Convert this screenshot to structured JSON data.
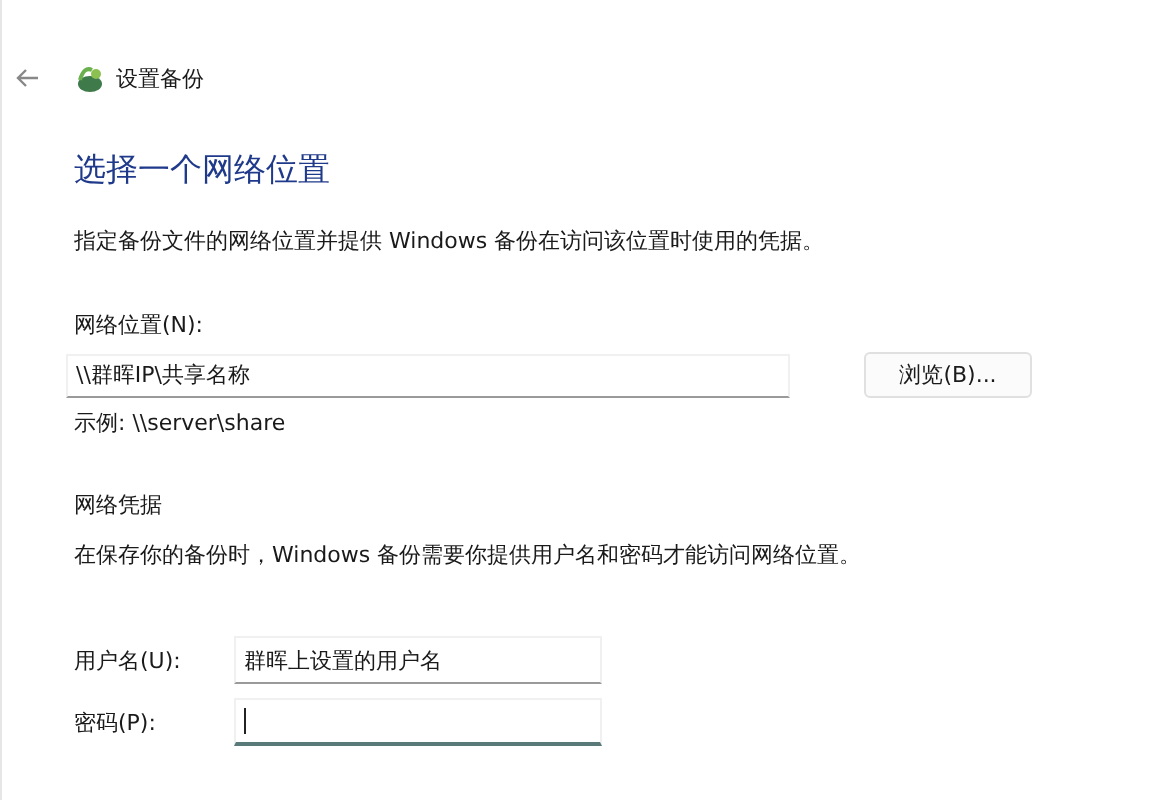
{
  "header": {
    "title": "设置备份"
  },
  "heading": "选择一个网络位置",
  "description": "指定备份文件的网络位置并提供 Windows 备份在访问该位置时使用的凭据。",
  "location": {
    "label": "网络位置(N):",
    "value": "\\\\群晖IP\\共享名称",
    "button": "浏览(B)...",
    "example": "示例: \\\\server\\share"
  },
  "credentials": {
    "title": "网络凭据",
    "description": "在保存你的备份时，Windows 备份需要你提供用户名和密码才能访问网络位置。",
    "fields": [
      {
        "label": "用户名(U):",
        "value": "群晖上设置的用户名",
        "focused": false
      },
      {
        "label": "密码(P):",
        "focused": true
      }
    ]
  }
}
